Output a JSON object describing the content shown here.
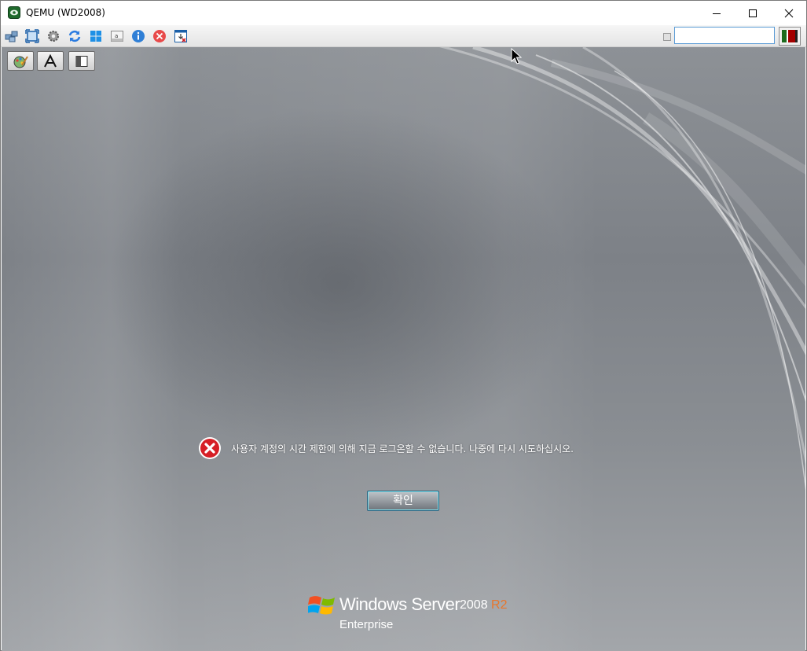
{
  "window": {
    "title": "QEMU (WD2008)",
    "controls": {
      "minimize": "minimize-icon",
      "maximize": "maximize-icon",
      "close": "close-icon"
    }
  },
  "toolbar": {
    "icons": [
      "connect-icon",
      "fullscreen-icon",
      "settings-icon",
      "refresh-icon",
      "windows-key-icon",
      "text-input-icon",
      "info-icon",
      "disconnect-icon",
      "capture-icon"
    ],
    "search_value": "",
    "flag_button": "color-flag-icon"
  },
  "overlay_buttons": [
    "color-edit-icon",
    "text-font-icon",
    "panel-toggle-icon"
  ],
  "login_screen": {
    "error_message": "사용자 계정의 시간 제한에 의해 지금 로그온할 수 없습니다. 나중에 다시 시도하십시오.",
    "ok_button": "확인",
    "brand": {
      "name": "Windows Server",
      "version": "2008",
      "release": "R2",
      "edition": "Enterprise"
    }
  },
  "colors": {
    "accent_orange": "#e8762b",
    "error_red": "#d61f26",
    "ok_glow": "#7fe3f0"
  }
}
